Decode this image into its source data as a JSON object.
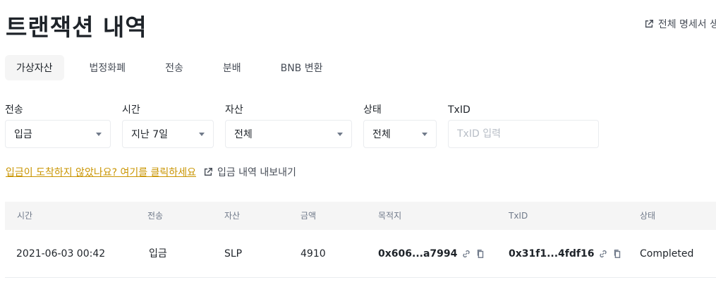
{
  "page": {
    "title": "트랜잭션 내역",
    "generate_statement": "전체 명세서 생"
  },
  "tabs": [
    {
      "label": "가상자산",
      "active": true
    },
    {
      "label": "법정화폐",
      "active": false
    },
    {
      "label": "전송",
      "active": false
    },
    {
      "label": "분배",
      "active": false
    },
    {
      "label": "BNB 변환",
      "active": false
    }
  ],
  "filters": {
    "transfer": {
      "label": "전송",
      "value": "입금"
    },
    "time": {
      "label": "시간",
      "value": "지난 7일"
    },
    "asset": {
      "label": "자산",
      "value": "전체"
    },
    "status": {
      "label": "상태",
      "value": "전체"
    },
    "txid": {
      "label": "TxID",
      "placeholder": "TxID 입력"
    }
  },
  "links": {
    "deposit_help": "입금이 도착하지 않았나요? 여기를 클릭하세요",
    "export": "입금 내역 내보내기"
  },
  "table": {
    "columns": [
      "시간",
      "전송",
      "자산",
      "금액",
      "목적지",
      "TxID",
      "상태"
    ],
    "rows": [
      {
        "time": "2021-06-03 00:42",
        "transfer": "입금",
        "asset": "SLP",
        "amount": "4910",
        "destination": "0x606...a7994",
        "txid": "0x31f1...4fdf16",
        "status": "Completed"
      }
    ]
  },
  "colors": {
    "accent_link": "#c99400",
    "header_bg": "#f5f5f5",
    "border": "#eaecef"
  }
}
